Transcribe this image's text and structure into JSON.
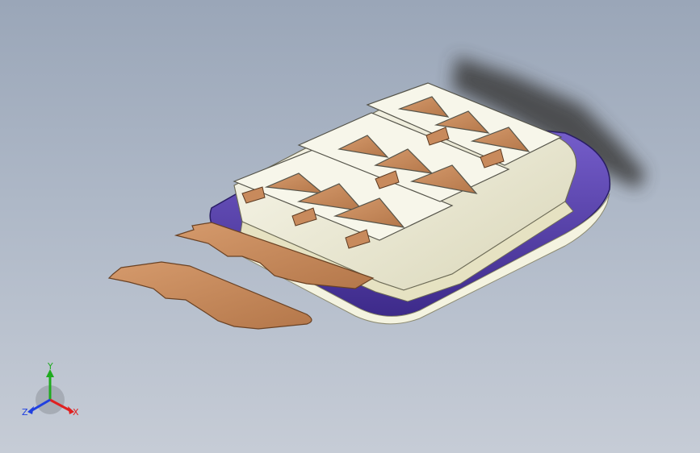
{
  "view": {
    "background_top": "#9aa6b8",
    "background_bottom": "#c6ccd6"
  },
  "model": {
    "tray_color": "#eeeccc",
    "base_rim_color": "#5a3fb0",
    "insert_color": "#c88a5c",
    "shadow_color": "#3c3c3c"
  },
  "triad": {
    "y_label": "Y",
    "x_label": "X",
    "z_label": "Z",
    "y_color": "#1faa1f",
    "x_color": "#e02020",
    "z_color": "#2040e0"
  }
}
